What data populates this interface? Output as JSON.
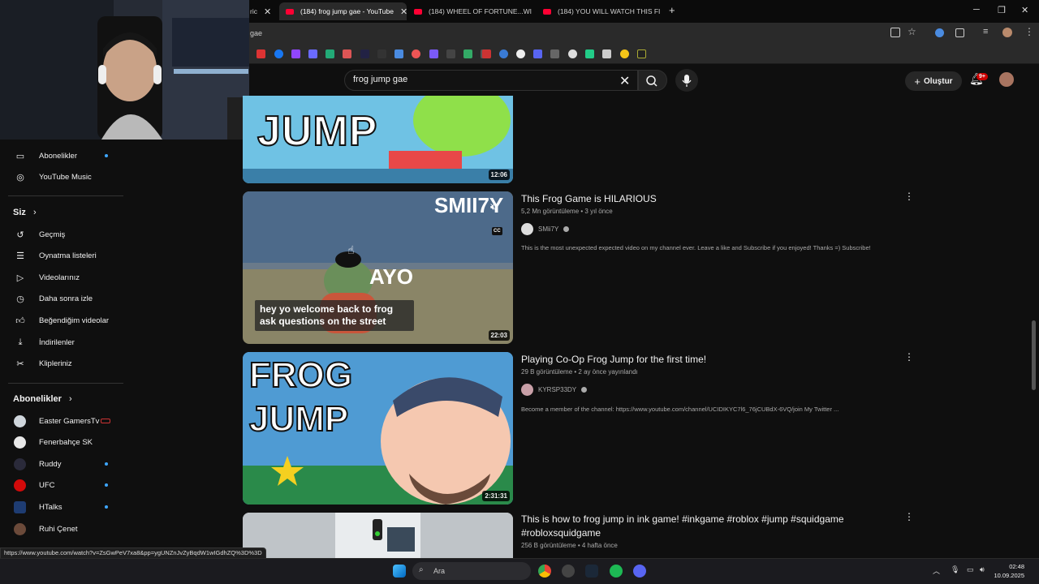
{
  "browser": {
    "tabs": [
      {
        "label": "ric"
      },
      {
        "label": "(184) frog jump gae - YouTube"
      },
      {
        "label": "(184) WHEEL OF FORTUNE...WI"
      },
      {
        "label": "(184) YOU WILL WATCH THIS FI"
      }
    ],
    "new_tab": "+",
    "address": "gae",
    "window": {
      "min": "─",
      "max": "❐",
      "close": "✕"
    }
  },
  "youtube": {
    "search_value": "frog jump gae",
    "create_label": "Oluştur",
    "notif_count": "9+"
  },
  "sidebar": {
    "top_items": [
      {
        "label": "Abonelikler",
        "icon": "subscriptions-icon"
      },
      {
        "label": "YouTube Music",
        "icon": "music-icon"
      }
    ],
    "you_heading": "Siz",
    "you_items": [
      {
        "label": "Geçmiş",
        "icon": "history-icon"
      },
      {
        "label": "Oynatma listeleri",
        "icon": "playlist-icon"
      },
      {
        "label": "Videolarınız",
        "icon": "your-videos-icon"
      },
      {
        "label": "Daha sonra izle",
        "icon": "watch-later-icon"
      },
      {
        "label": "Beğendiğim videolar",
        "icon": "like-icon"
      },
      {
        "label": "İndirilenler",
        "icon": "download-icon"
      },
      {
        "label": "Klipleriniz",
        "icon": "clips-icon"
      }
    ],
    "subs_heading": "Abonelikler",
    "subs": [
      {
        "label": "Easter GamersTv"
      },
      {
        "label": "Fenerbahçe SK"
      },
      {
        "label": "Ruddy"
      },
      {
        "label": "UFC"
      },
      {
        "label": "HTalks"
      },
      {
        "label": "Ruhi Çenet"
      }
    ]
  },
  "results": [
    {
      "thumb_text": "JUMP",
      "duration": "12:06"
    },
    {
      "title": "This Frog Game is HILARIOUS",
      "meta": "5,2 Mn görüntüleme • 3 yıl önce",
      "channel": "SMii7Y",
      "description": "This is the most unexpected expected video on my channel ever. Leave a like and Subscribe if you enjoyed! Thanks =) Subscribe!",
      "duration": "22:03",
      "thumb_logo": "SMII7Y",
      "thumb_ayo": "AYO",
      "thumb_caption": "hey yo welcome back to frog ask questions on the street",
      "cc": "CC"
    },
    {
      "title": "Playing Co-Op Frog Jump for the first time!",
      "meta": "29 B görüntüleme • 2 ay önce yayınlandı",
      "channel": "KYRSP33DY",
      "description": "Become a member of the channel: https://www.youtube.com/channel/UCIDIKYC7l6_76jCUBdX-6VQ/join My Twitter ...",
      "duration": "2:31:31",
      "thumb_l1": "FROG",
      "thumb_l2": "JUMP"
    },
    {
      "title": "This is how to frog jump in ink game! #inkgame #roblox #jump #squidgame #robloxsquidgame",
      "meta": "256 B görüntüleme • 4 hafta önce"
    }
  ],
  "status_url": "https://www.youtube.com/watch?v=ZsGwPeV7xa8&pp=ygUNZnJvZyBqdW1wIGdhZQ%3D%3D",
  "taskbar": {
    "search_label": "Ara",
    "time": "02:48",
    "date": "10.09.2025"
  }
}
